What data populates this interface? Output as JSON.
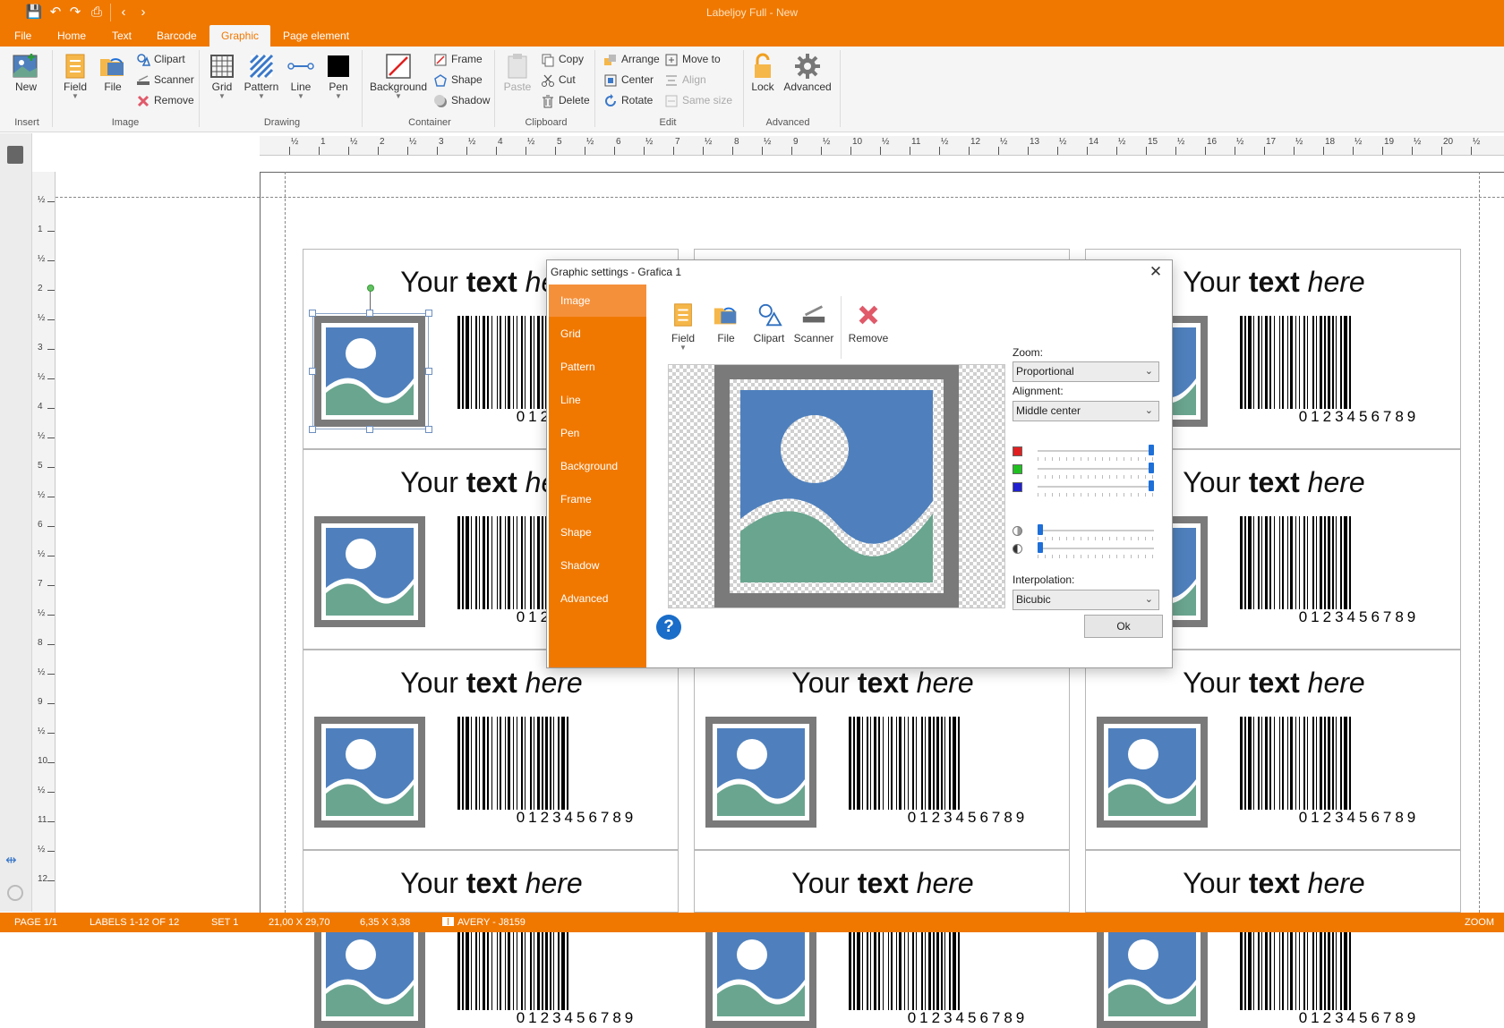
{
  "app": {
    "title": "Labeljoy Full - New"
  },
  "menu": {
    "tabs": [
      "File",
      "Home",
      "Text",
      "Barcode",
      "Graphic",
      "Page element"
    ],
    "active": "Graphic"
  },
  "ribbon": {
    "insert": {
      "new": "New",
      "group": "Insert"
    },
    "image": {
      "field": "Field",
      "file": "File",
      "clipart": "Clipart",
      "scanner": "Scanner",
      "remove": "Remove",
      "group": "Image"
    },
    "drawing": {
      "grid": "Grid",
      "pattern": "Pattern",
      "line": "Line",
      "pen": "Pen",
      "group": "Drawing"
    },
    "container": {
      "background": "Background",
      "frame": "Frame",
      "shape": "Shape",
      "shadow": "Shadow",
      "group": "Container"
    },
    "clipboard": {
      "paste": "Paste",
      "copy": "Copy",
      "cut": "Cut",
      "delete": "Delete",
      "group": "Clipboard"
    },
    "edit": {
      "arrange": "Arrange",
      "move_to": "Move to",
      "center": "Center",
      "align": "Align",
      "rotate": "Rotate",
      "same_size": "Same size",
      "group": "Edit"
    },
    "advanced": {
      "lock": "Lock",
      "advanced": "Advanced",
      "group": "Advanced"
    }
  },
  "ruler": {
    "h": [
      "½",
      "1",
      "½",
      "2",
      "½",
      "3",
      "½",
      "4",
      "½",
      "5",
      "½",
      "6",
      "½",
      "7",
      "½",
      "8",
      "½",
      "9",
      "½",
      "10",
      "½",
      "11",
      "½",
      "12",
      "½",
      "13",
      "½",
      "14",
      "½",
      "15",
      "½",
      "16",
      "½",
      "17",
      "½",
      "18",
      "½",
      "19",
      "½",
      "20",
      "½"
    ],
    "v": [
      "½",
      "1",
      "½",
      "2",
      "½",
      "3",
      "½",
      "4",
      "½",
      "5",
      "½",
      "6",
      "½",
      "7",
      "½",
      "8",
      "½",
      "9",
      "½",
      "10",
      "½",
      "11",
      "½",
      "12"
    ]
  },
  "label": {
    "text_prefix": "Your",
    "text_bold": "text",
    "text_italic": "here",
    "barcode_digits": "0123456789"
  },
  "dialog": {
    "title": "Graphic settings - Grafica 1",
    "close": "✕",
    "nav": [
      "Image",
      "Grid",
      "Pattern",
      "Line",
      "Pen",
      "Background",
      "Frame",
      "Shape",
      "Shadow",
      "Advanced"
    ],
    "active_nav": "Image",
    "toolbar": {
      "field": "Field",
      "file": "File",
      "clipart": "Clipart",
      "scanner": "Scanner",
      "remove": "Remove"
    },
    "zoom_label": "Zoom:",
    "zoom_value": "Proportional",
    "alignment_label": "Alignment:",
    "alignment_value": "Middle center",
    "interpolation_label": "Interpolation:",
    "interpolation_value": "Bicubic",
    "color_levels": {
      "red": 1.0,
      "green": 1.0,
      "blue": 1.0
    },
    "brightness": 0.0,
    "contrast": 0.0,
    "help": "?",
    "ok": "Ok"
  },
  "status": {
    "page": "PAGE 1/1",
    "labels": "LABELS 1-12 OF 12",
    "set": "SET 1",
    "page_size": "21,00 X 29,70",
    "label_size": "6,35 X 3,38",
    "template": "AVERY - J8159",
    "zoom": "ZOOM"
  },
  "colors": {
    "accent": "#f07800",
    "image_blue": "#4f80bd",
    "image_green": "#6aa58f",
    "frame_gray": "#808080"
  }
}
